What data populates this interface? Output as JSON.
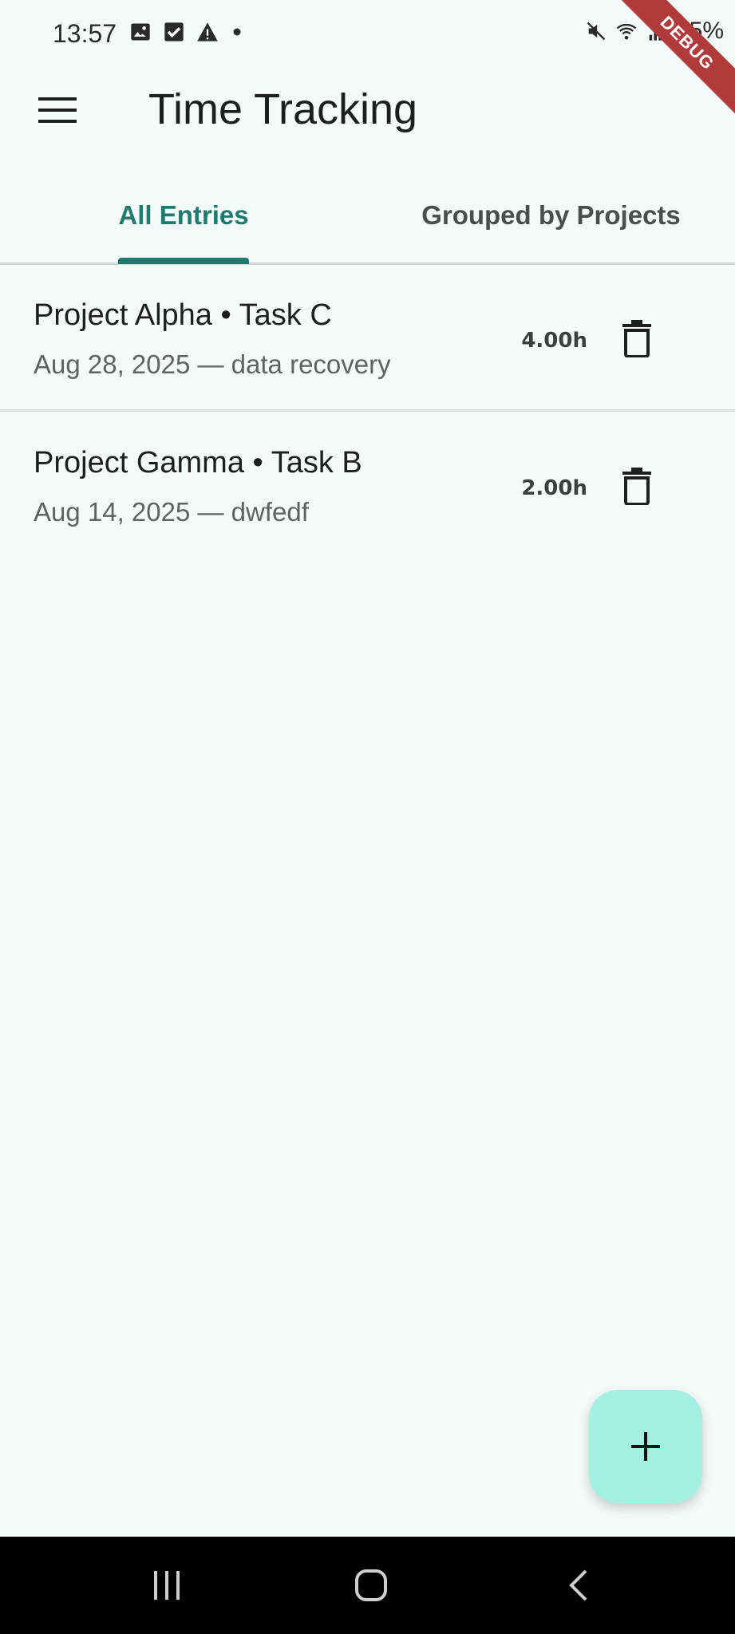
{
  "status_bar": {
    "time": "13:57",
    "battery": "65%",
    "left_icons": [
      "image-icon",
      "check-box-icon",
      "warning-icon",
      "dot-icon"
    ],
    "right_icons": [
      "mute-icon",
      "wifi-icon",
      "signal-icon",
      "battery-icon"
    ]
  },
  "debug_banner": "DEBUG",
  "app_bar": {
    "title": "Time Tracking",
    "menu_icon": "menu-icon"
  },
  "tabs": [
    {
      "label": "All Entries",
      "selected": true
    },
    {
      "label": "Grouped by Projects",
      "selected": false
    }
  ],
  "entries": [
    {
      "title": "Project Alpha • Task C",
      "subtitle": "Aug 28, 2025  —  data recovery",
      "hours": "4.00h",
      "delete_icon": "trash-icon"
    },
    {
      "title": "Project Gamma • Task B",
      "subtitle": "Aug 14, 2025  —  dwfedf",
      "hours": "2.00h",
      "delete_icon": "trash-icon"
    }
  ],
  "fab": {
    "icon": "plus-icon"
  },
  "nav_bar": {
    "icons": [
      "recents-icon",
      "home-icon",
      "back-icon"
    ]
  },
  "colors": {
    "background": "#f4faf8",
    "accent": "#1f7a6f",
    "fab": "#a3efe2",
    "debug_ribbon": "#b13a3a"
  }
}
